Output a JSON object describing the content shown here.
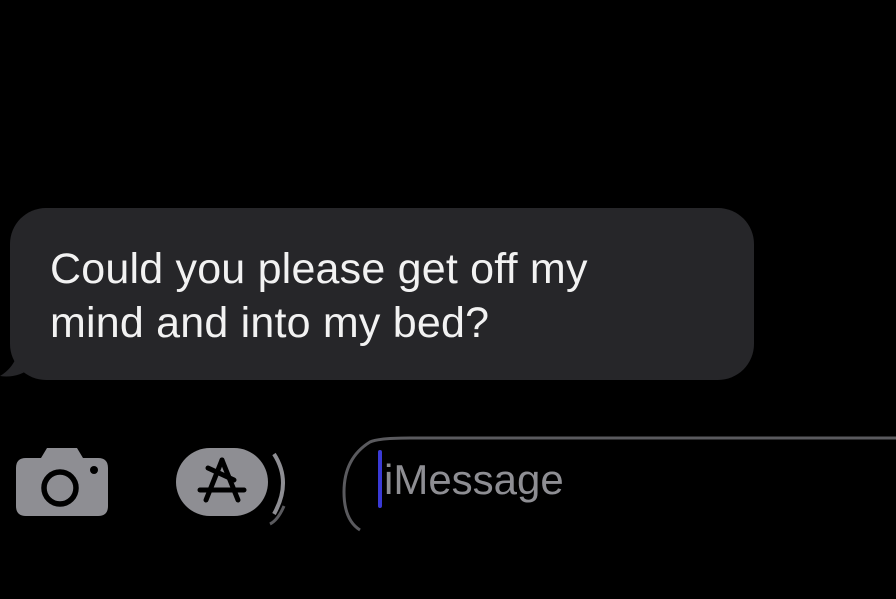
{
  "conversation": {
    "messages": [
      {
        "direction": "incoming",
        "lines": [
          "Could you please get off my",
          "mind and into my bed?"
        ]
      }
    ]
  },
  "composer": {
    "camera_icon": "camera-icon",
    "apps_icon": "app-store-icon",
    "input": {
      "value": "",
      "placeholder": "iMessage"
    }
  },
  "colors": {
    "background": "#000000",
    "incoming_bubble": "#262629",
    "message_text": "#f2f2f2",
    "control_fill": "#8e8e93",
    "cursor": "#3a3ad6"
  }
}
